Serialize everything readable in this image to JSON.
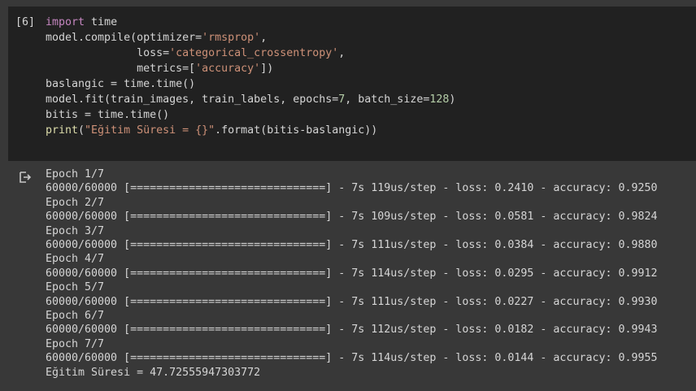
{
  "cell": {
    "execution_count": "[6]",
    "code_lines": [
      [
        {
          "t": "import",
          "c": "kw"
        },
        {
          "t": " time",
          "c": ""
        }
      ],
      [
        {
          "t": "model.compile(optimizer=",
          "c": ""
        },
        {
          "t": "'rmsprop'",
          "c": "str"
        },
        {
          "t": ",",
          "c": ""
        }
      ],
      [
        {
          "t": "              loss=",
          "c": ""
        },
        {
          "t": "'categorical_crossentropy'",
          "c": "str"
        },
        {
          "t": ",",
          "c": ""
        }
      ],
      [
        {
          "t": "              metrics=[",
          "c": ""
        },
        {
          "t": "'accuracy'",
          "c": "str"
        },
        {
          "t": "])",
          "c": ""
        }
      ],
      [
        {
          "t": "baslangic = time.time()",
          "c": ""
        }
      ],
      [
        {
          "t": "model.fit(train_images, train_labels, epochs=",
          "c": ""
        },
        {
          "t": "7",
          "c": "num"
        },
        {
          "t": ", batch_size=",
          "c": ""
        },
        {
          "t": "128",
          "c": "num"
        },
        {
          "t": ")",
          "c": ""
        }
      ],
      [
        {
          "t": "bitis = time.time()",
          "c": ""
        }
      ],
      [
        {
          "t": "print",
          "c": "fn"
        },
        {
          "t": "(",
          "c": ""
        },
        {
          "t": "\"Eğitim Süresi = {}\"",
          "c": "str"
        },
        {
          "t": ".format(bitis-baslangic))",
          "c": ""
        }
      ]
    ]
  },
  "output": {
    "icon": "output-redirect-icon",
    "lines": [
      "Epoch 1/7",
      "60000/60000 [==============================] - 7s 119us/step - loss: 0.2410 - accuracy: 0.9250",
      "Epoch 2/7",
      "60000/60000 [==============================] - 7s 109us/step - loss: 0.0581 - accuracy: 0.9824",
      "Epoch 3/7",
      "60000/60000 [==============================] - 7s 111us/step - loss: 0.0384 - accuracy: 0.9880",
      "Epoch 4/7",
      "60000/60000 [==============================] - 7s 114us/step - loss: 0.0295 - accuracy: 0.9912",
      "Epoch 5/7",
      "60000/60000 [==============================] - 7s 111us/step - loss: 0.0227 - accuracy: 0.9930",
      "Epoch 6/7",
      "60000/60000 [==============================] - 7s 112us/step - loss: 0.0182 - accuracy: 0.9943",
      "Epoch 7/7",
      "60000/60000 [==============================] - 7s 114us/step - loss: 0.0144 - accuracy: 0.9955",
      "Eğitim Süresi = 47.72555947303772"
    ]
  },
  "colors": {
    "page_bg": "#383838",
    "cell_bg": "#212121",
    "text": "#d5d5d5",
    "keyword": "#c586c0",
    "string": "#ce9178",
    "number": "#b5cea8"
  }
}
